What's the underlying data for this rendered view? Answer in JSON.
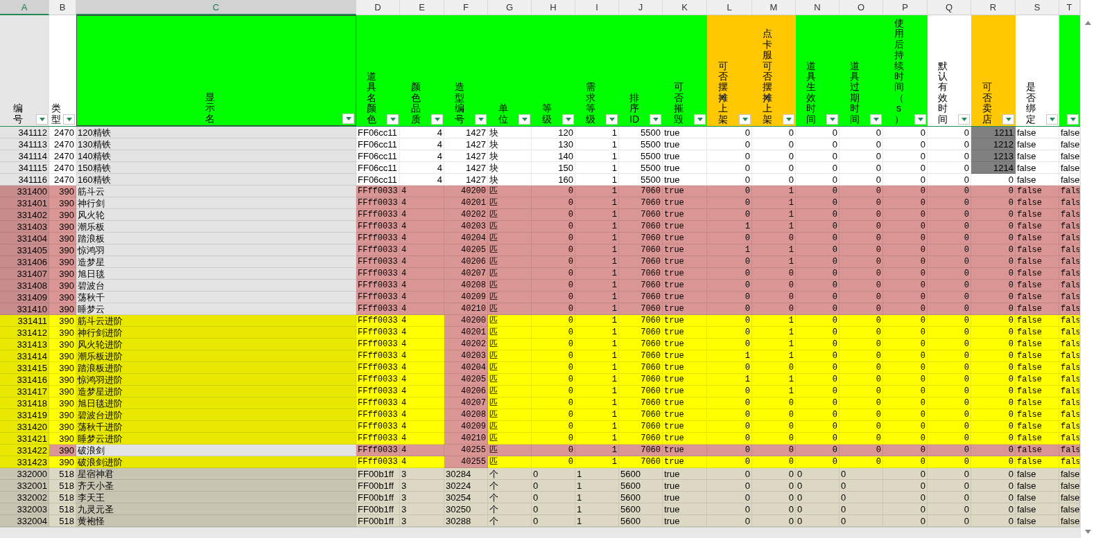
{
  "columns": [
    {
      "letter": "A",
      "label": "编号",
      "color": "#e6e6e6",
      "selected": true
    },
    {
      "letter": "B",
      "label": "类型",
      "color": "#ffffff",
      "selected": false
    },
    {
      "letter": "C",
      "label": "显示名",
      "color": "#00ff00",
      "selected": true
    },
    {
      "letter": "D",
      "label": "道具名颜色",
      "color": "#00ff00",
      "selected": false
    },
    {
      "letter": "E",
      "label": "颜色品质",
      "color": "#00ff00",
      "selected": false
    },
    {
      "letter": "F",
      "label": "造型编号",
      "color": "#00ff00",
      "selected": false
    },
    {
      "letter": "G",
      "label": "单位",
      "color": "#00ff00",
      "selected": false
    },
    {
      "letter": "H",
      "label": "等级",
      "color": "#00ff00",
      "selected": false
    },
    {
      "letter": "I",
      "label": "需求等级",
      "color": "#00ff00",
      "selected": false
    },
    {
      "letter": "J",
      "label": "排序ID",
      "color": "#00ff00",
      "selected": false
    },
    {
      "letter": "K",
      "label": "可否摧毁",
      "color": "#00ff00",
      "selected": false
    },
    {
      "letter": "L",
      "label": "可否摆摊上架",
      "color": "#ffc800",
      "selected": false
    },
    {
      "letter": "M",
      "label": "点卡服可否摆摊上架",
      "color": "#ffc800",
      "selected": false
    },
    {
      "letter": "N",
      "label": "道具生效时间",
      "color": "#00ff00",
      "selected": false
    },
    {
      "letter": "O",
      "label": "道具过期时间",
      "color": "#00ff00",
      "selected": false
    },
    {
      "letter": "P",
      "label": "使用后持续时间（s）",
      "color": "#00ff00",
      "selected": false
    },
    {
      "letter": "Q",
      "label": "默认有效时间",
      "color": "#ffffff",
      "selected": false
    },
    {
      "letter": "R",
      "label": "可否卖店",
      "color": "#ffc800",
      "selected": false
    },
    {
      "letter": "S",
      "label": "是否绑定",
      "color": "#ffffff",
      "selected": false
    },
    {
      "letter": "T",
      "color": "#00ff00",
      "selected": false
    }
  ],
  "rows": [
    {
      "kind": "plain",
      "marked": true,
      "cells": [
        "341112",
        "2470",
        "120精铁",
        "FF06cc11",
        "4",
        "1427",
        "块",
        "120",
        "1",
        "5500",
        "true",
        "0",
        "0",
        "0",
        "0",
        "0",
        "0",
        "1211",
        "false",
        "false"
      ]
    },
    {
      "kind": "plain",
      "marked": true,
      "cells": [
        "341113",
        "2470",
        "130精铁",
        "FF06cc11",
        "4",
        "1427",
        "块",
        "130",
        "1",
        "5500",
        "true",
        "0",
        "0",
        "0",
        "0",
        "0",
        "0",
        "1212",
        "false",
        "false"
      ]
    },
    {
      "kind": "plain",
      "marked": true,
      "cells": [
        "341114",
        "2470",
        "140精铁",
        "FF06cc11",
        "4",
        "1427",
        "块",
        "140",
        "1",
        "5500",
        "true",
        "0",
        "0",
        "0",
        "0",
        "0",
        "0",
        "1213",
        "false",
        "false"
      ]
    },
    {
      "kind": "plain",
      "marked": true,
      "cells": [
        "341115",
        "2470",
        "150精铁",
        "FF06cc11",
        "4",
        "1427",
        "块",
        "150",
        "1",
        "5500",
        "true",
        "0",
        "0",
        "0",
        "0",
        "0",
        "0",
        "1214",
        "false",
        "false"
      ]
    },
    {
      "kind": "plain",
      "marked": false,
      "cells": [
        "341116",
        "2470",
        "160精铁",
        "FF06cc11",
        "4",
        "1427",
        "块",
        "160",
        "1",
        "5500",
        "true",
        "0",
        "0",
        "0",
        "0",
        "0",
        "0",
        "0",
        "false",
        "false"
      ]
    },
    {
      "kind": "pink",
      "marked": false,
      "cells": [
        "331400",
        "390",
        "筋斗云",
        "FFff0033",
        "4",
        "40200",
        "匹",
        "0",
        "1",
        "7060",
        "true",
        "0",
        "1",
        "0",
        "0",
        "0",
        "0",
        "0",
        "false",
        "fals"
      ]
    },
    {
      "kind": "pink",
      "marked": false,
      "cells": [
        "331401",
        "390",
        "神行剑",
        "FFff0033",
        "4",
        "40201",
        "匹",
        "0",
        "1",
        "7060",
        "true",
        "0",
        "1",
        "0",
        "0",
        "0",
        "0",
        "0",
        "false",
        "fals"
      ]
    },
    {
      "kind": "pink",
      "marked": false,
      "cells": [
        "331402",
        "390",
        "风火轮",
        "FFff0033",
        "4",
        "40202",
        "匹",
        "0",
        "1",
        "7060",
        "true",
        "0",
        "1",
        "0",
        "0",
        "0",
        "0",
        "0",
        "false",
        "fals"
      ]
    },
    {
      "kind": "pink",
      "marked": false,
      "cells": [
        "331403",
        "390",
        "潮乐板",
        "FFff0033",
        "4",
        "40203",
        "匹",
        "0",
        "1",
        "7060",
        "true",
        "1",
        "1",
        "0",
        "0",
        "0",
        "0",
        "0",
        "false",
        "fals"
      ]
    },
    {
      "kind": "pink",
      "marked": false,
      "cells": [
        "331404",
        "390",
        "踏浪板",
        "FFff0033",
        "4",
        "40204",
        "匹",
        "0",
        "1",
        "7060",
        "true",
        "0",
        "0",
        "0",
        "0",
        "0",
        "0",
        "0",
        "false",
        "fals"
      ]
    },
    {
      "kind": "pink",
      "marked": false,
      "cells": [
        "331405",
        "390",
        "惊鸿羽",
        "FFff0033",
        "4",
        "40205",
        "匹",
        "0",
        "1",
        "7060",
        "true",
        "1",
        "1",
        "0",
        "0",
        "0",
        "0",
        "0",
        "false",
        "fals"
      ]
    },
    {
      "kind": "pink",
      "marked": false,
      "cells": [
        "331406",
        "390",
        "造梦星",
        "FFff0033",
        "4",
        "40206",
        "匹",
        "0",
        "1",
        "7060",
        "true",
        "0",
        "1",
        "0",
        "0",
        "0",
        "0",
        "0",
        "false",
        "fals"
      ]
    },
    {
      "kind": "pink",
      "marked": false,
      "cells": [
        "331407",
        "390",
        "旭日毯",
        "FFff0033",
        "4",
        "40207",
        "匹",
        "0",
        "1",
        "7060",
        "true",
        "0",
        "0",
        "0",
        "0",
        "0",
        "0",
        "0",
        "false",
        "fals"
      ]
    },
    {
      "kind": "pink",
      "marked": false,
      "cells": [
        "331408",
        "390",
        "碧波台",
        "FFff0033",
        "4",
        "40208",
        "匹",
        "0",
        "1",
        "7060",
        "true",
        "0",
        "0",
        "0",
        "0",
        "0",
        "0",
        "0",
        "false",
        "fals"
      ]
    },
    {
      "kind": "pink",
      "marked": false,
      "cells": [
        "331409",
        "390",
        "荡秋千",
        "FFff0033",
        "4",
        "40209",
        "匹",
        "0",
        "1",
        "7060",
        "true",
        "0",
        "0",
        "0",
        "0",
        "0",
        "0",
        "0",
        "false",
        "fals"
      ]
    },
    {
      "kind": "pink",
      "marked": false,
      "cells": [
        "331410",
        "390",
        "睡梦云",
        "FFff0033",
        "4",
        "40210",
        "匹",
        "0",
        "1",
        "7060",
        "true",
        "0",
        "0",
        "0",
        "0",
        "0",
        "0",
        "0",
        "false",
        "fals"
      ]
    },
    {
      "kind": "yellow",
      "marked": false,
      "cells": [
        "331411",
        "390",
        "筋斗云进阶",
        "FFff0033",
        "4",
        "40200",
        "匹",
        "0",
        "1",
        "7060",
        "true",
        "0",
        "1",
        "0",
        "0",
        "0",
        "0",
        "0",
        "false",
        "fals"
      ]
    },
    {
      "kind": "yellow",
      "marked": false,
      "cells": [
        "331412",
        "390",
        "神行剑进阶",
        "FFff0033",
        "4",
        "40201",
        "匹",
        "0",
        "1",
        "7060",
        "true",
        "0",
        "1",
        "0",
        "0",
        "0",
        "0",
        "0",
        "false",
        "fals"
      ]
    },
    {
      "kind": "yellow",
      "marked": false,
      "cells": [
        "331413",
        "390",
        "风火轮进阶",
        "FFff0033",
        "4",
        "40202",
        "匹",
        "0",
        "1",
        "7060",
        "true",
        "0",
        "1",
        "0",
        "0",
        "0",
        "0",
        "0",
        "false",
        "fals"
      ]
    },
    {
      "kind": "yellow",
      "marked": false,
      "cells": [
        "331414",
        "390",
        "潮乐板进阶",
        "FFff0033",
        "4",
        "40203",
        "匹",
        "0",
        "1",
        "7060",
        "true",
        "1",
        "1",
        "0",
        "0",
        "0",
        "0",
        "0",
        "false",
        "fals"
      ]
    },
    {
      "kind": "yellow",
      "marked": false,
      "cells": [
        "331415",
        "390",
        "踏浪板进阶",
        "FFff0033",
        "4",
        "40204",
        "匹",
        "0",
        "1",
        "7060",
        "true",
        "0",
        "0",
        "0",
        "0",
        "0",
        "0",
        "0",
        "false",
        "fals"
      ]
    },
    {
      "kind": "yellow",
      "marked": false,
      "cells": [
        "331416",
        "390",
        "惊鸿羽进阶",
        "FFff0033",
        "4",
        "40205",
        "匹",
        "0",
        "1",
        "7060",
        "true",
        "1",
        "1",
        "0",
        "0",
        "0",
        "0",
        "0",
        "false",
        "fals"
      ]
    },
    {
      "kind": "yellow",
      "marked": false,
      "cells": [
        "331417",
        "390",
        "造梦星进阶",
        "FFff0033",
        "4",
        "40206",
        "匹",
        "0",
        "1",
        "7060",
        "true",
        "0",
        "1",
        "0",
        "0",
        "0",
        "0",
        "0",
        "false",
        "fals"
      ]
    },
    {
      "kind": "yellow",
      "marked": false,
      "cells": [
        "331418",
        "390",
        "旭日毯进阶",
        "FFff0033",
        "4",
        "40207",
        "匹",
        "0",
        "1",
        "7060",
        "true",
        "0",
        "0",
        "0",
        "0",
        "0",
        "0",
        "0",
        "false",
        "fals"
      ]
    },
    {
      "kind": "yellow",
      "marked": false,
      "cells": [
        "331419",
        "390",
        "碧波台进阶",
        "FFff0033",
        "4",
        "40208",
        "匹",
        "0",
        "1",
        "7060",
        "true",
        "0",
        "0",
        "0",
        "0",
        "0",
        "0",
        "0",
        "false",
        "fals"
      ]
    },
    {
      "kind": "yellow",
      "marked": false,
      "cells": [
        "331420",
        "390",
        "荡秋千进阶",
        "FFff0033",
        "4",
        "40209",
        "匹",
        "0",
        "1",
        "7060",
        "true",
        "0",
        "0",
        "0",
        "0",
        "0",
        "0",
        "0",
        "false",
        "fals"
      ]
    },
    {
      "kind": "yellow",
      "marked": false,
      "cells": [
        "331421",
        "390",
        "睡梦云进阶",
        "FFff0033",
        "4",
        "40210",
        "匹",
        "0",
        "1",
        "7060",
        "true",
        "0",
        "0",
        "0",
        "0",
        "0",
        "0",
        "0",
        "false",
        "fals"
      ]
    },
    {
      "kind": "mixed",
      "marked": false,
      "cells": [
        "331422",
        "390",
        "破浪剑",
        "FFff0033",
        "4",
        "40255",
        "匹",
        "0",
        "1",
        "7060",
        "true",
        "0",
        "0",
        "0",
        "0",
        "0",
        "0",
        "0",
        "false",
        "fals"
      ]
    },
    {
      "kind": "yellow",
      "marked": false,
      "cells": [
        "331423",
        "390",
        "破浪剑进阶",
        "FFff0033",
        "4",
        "40255",
        "匹",
        "0",
        "1",
        "7060",
        "true",
        "0",
        "0",
        "0",
        "0",
        "0",
        "0",
        "0",
        "false",
        "fals"
      ]
    },
    {
      "kind": "tan",
      "marked": false,
      "cells": [
        "332000",
        "518",
        "星宿神君",
        "FF00b1ff",
        "3",
        "30284",
        "个",
        "0",
        "1",
        "5600",
        "true",
        "0",
        "0",
        "0",
        "0",
        "0",
        "0",
        "0",
        "false",
        "false"
      ]
    },
    {
      "kind": "tan",
      "marked": false,
      "cells": [
        "332001",
        "518",
        "齐天小圣",
        "FF00b1ff",
        "3",
        "30224",
        "个",
        "0",
        "1",
        "5600",
        "true",
        "0",
        "0",
        "0",
        "0",
        "0",
        "0",
        "0",
        "false",
        "false"
      ]
    },
    {
      "kind": "tan",
      "marked": false,
      "cells": [
        "332002",
        "518",
        "李天王",
        "FF00b1ff",
        "3",
        "30254",
        "个",
        "0",
        "1",
        "5600",
        "true",
        "0",
        "0",
        "0",
        "0",
        "0",
        "0",
        "0",
        "false",
        "false"
      ]
    },
    {
      "kind": "tan",
      "marked": false,
      "cells": [
        "332003",
        "518",
        "九灵元圣",
        "FF00b1ff",
        "3",
        "30250",
        "个",
        "0",
        "1",
        "5600",
        "true",
        "0",
        "0",
        "0",
        "0",
        "0",
        "0",
        "0",
        "false",
        "false"
      ]
    },
    {
      "kind": "tan",
      "marked": false,
      "cells": [
        "332004",
        "518",
        "黄袍怪",
        "FF00b1ff",
        "3",
        "30288",
        "个",
        "0",
        "1",
        "5600",
        "true",
        "0",
        "0",
        "0",
        "0",
        "0",
        "0",
        "0",
        "false",
        "false"
      ]
    }
  ]
}
